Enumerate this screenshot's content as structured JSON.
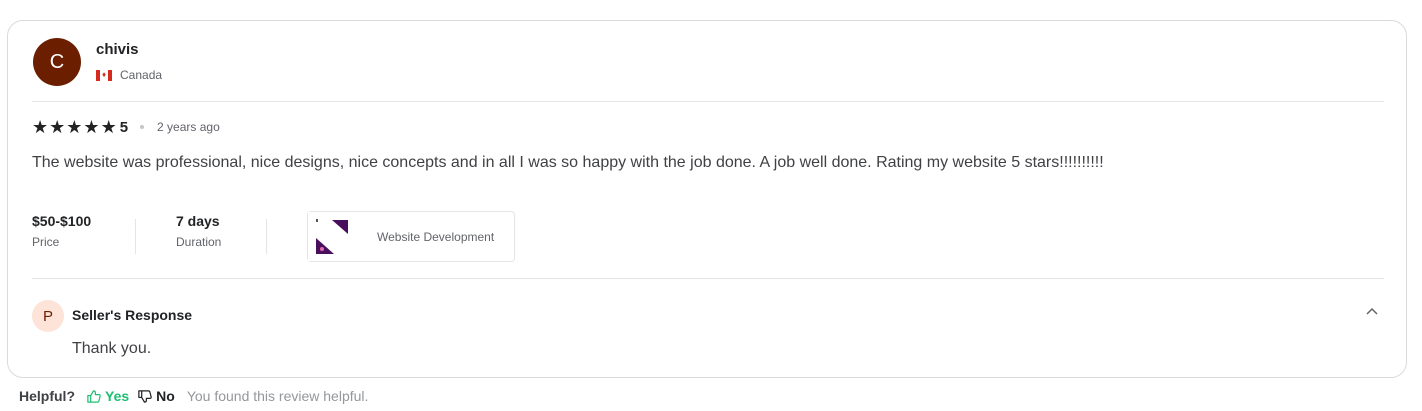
{
  "reviewer": {
    "initial": "C",
    "name": "chivis",
    "country": "Canada"
  },
  "review": {
    "rating": 5,
    "rating_label": "5",
    "time_ago": "2 years ago",
    "text": "The website was professional, nice designs, nice concepts and in all I was so happy with the job done. A job well done. Rating my website 5 stars!!!!!!!!!!"
  },
  "meta": {
    "price_value": "$50-$100",
    "price_label": "Price",
    "duration_value": "7 days",
    "duration_label": "Duration",
    "gig_title": "Website Development"
  },
  "seller_response": {
    "initial": "P",
    "title": "Seller's Response",
    "text": "Thank you.",
    "expanded": true
  },
  "helpful": {
    "question": "Helpful?",
    "yes_label": "Yes",
    "no_label": "No",
    "note": "You found this review helpful."
  },
  "colors": {
    "avatar_bg": "#6b1f00",
    "response_avatar_bg": "#fde3d8",
    "yes_green": "#1dbf73",
    "border": "#dadbdd"
  }
}
